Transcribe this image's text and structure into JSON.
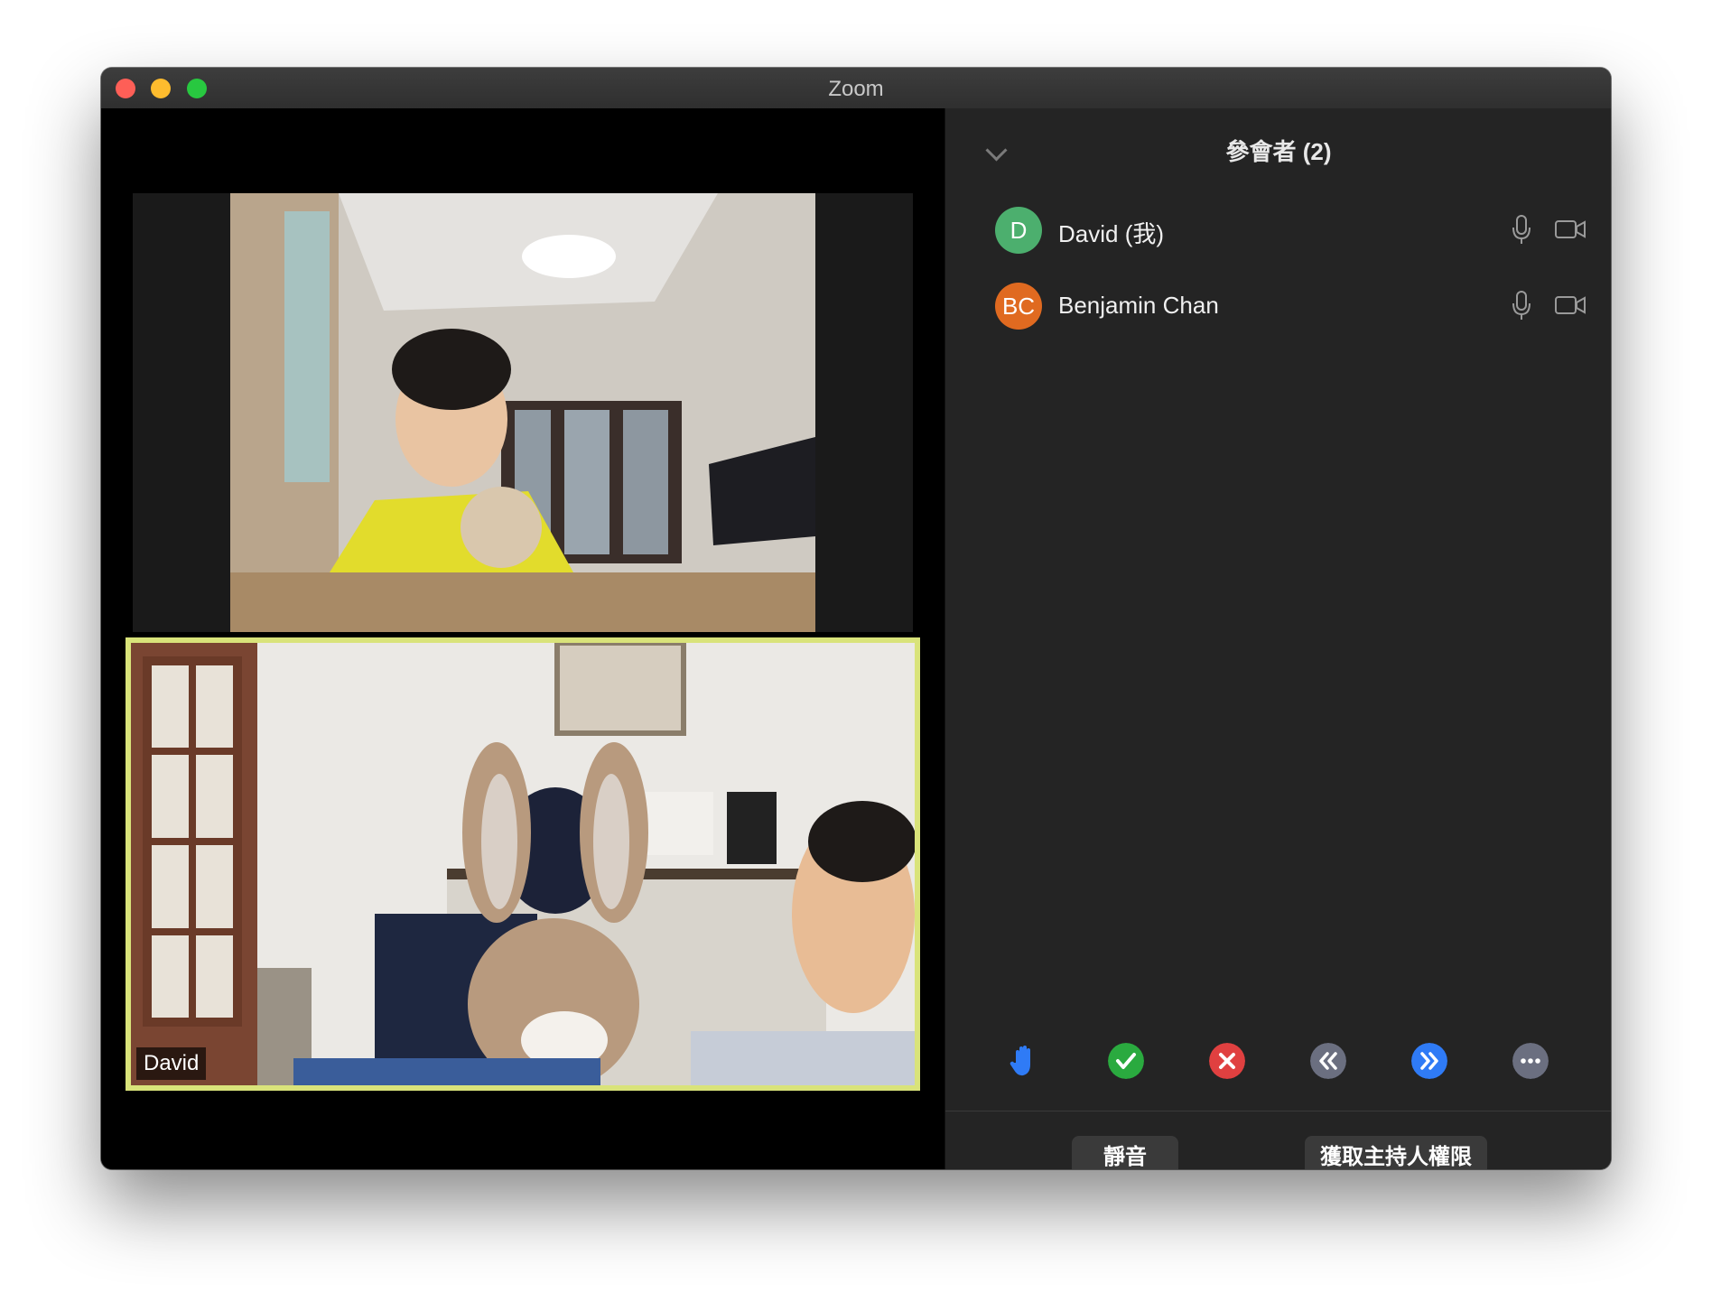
{
  "window": {
    "title": "Zoom"
  },
  "video": {
    "self_name": "David"
  },
  "participants_panel": {
    "title": "參會者 (2)",
    "participants": [
      {
        "initials": "D",
        "name": "David (我)",
        "avatar_color": "#4caf6e"
      },
      {
        "initials": "BC",
        "name": "Benjamin Chan",
        "avatar_color": "#e06a20"
      }
    ]
  },
  "reactions": [
    {
      "icon": "raise-hand-icon",
      "color": "#2f7bf6"
    },
    {
      "icon": "yes-check-icon",
      "color": "#2aaa3f"
    },
    {
      "icon": "no-x-icon",
      "color": "#e04040"
    },
    {
      "icon": "go-slower-icon",
      "color": "#6b6f80"
    },
    {
      "icon": "go-faster-icon",
      "color": "#2f7bf6"
    },
    {
      "icon": "more-icon",
      "color": "#6b6f80"
    }
  ],
  "buttons": {
    "mute": "靜音",
    "claim_host": "獲取主持人權限"
  }
}
